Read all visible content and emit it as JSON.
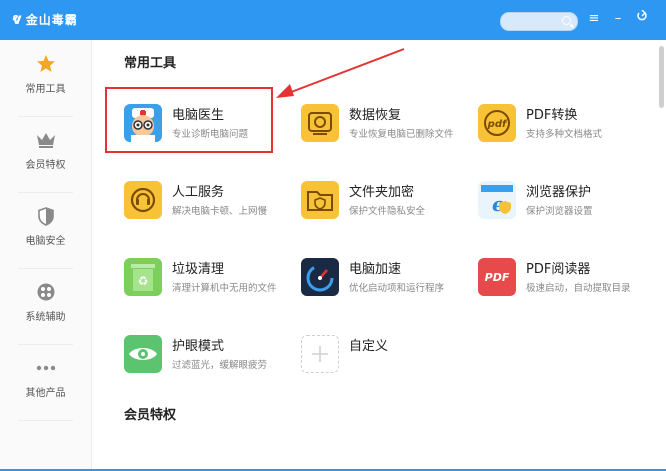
{
  "app": {
    "title": "金山毒霸"
  },
  "window_controls": [
    "menu-icon",
    "minimize-icon",
    "restore-icon"
  ],
  "sidebar": {
    "items": [
      {
        "label": "常用工具",
        "icon": "star-icon",
        "active": true
      },
      {
        "label": "会员特权",
        "icon": "crown-icon"
      },
      {
        "label": "电脑安全",
        "icon": "shield-icon"
      },
      {
        "label": "系统辅助",
        "icon": "settings-circle-icon"
      },
      {
        "label": "其他产品",
        "icon": "more-dots-icon"
      }
    ]
  },
  "main": {
    "section1_title": "常用工具",
    "section2_title": "会员特权",
    "tools": [
      {
        "name": "电脑医生",
        "desc": "专业诊断电脑问题",
        "icon": "doctor-icon"
      },
      {
        "name": "数据恢复",
        "desc": "专业恢复电脑已删除文件",
        "icon": "data-recovery-icon"
      },
      {
        "name": "PDF转换",
        "desc": "支持多种文档格式",
        "icon": "pdf-convert-icon",
        "icon_text": "pdf"
      },
      {
        "name": "人工服务",
        "desc": "解决电脑卡顿、上网慢",
        "icon": "headset-icon"
      },
      {
        "name": "文件夹加密",
        "desc": "保护文件隐私安全",
        "icon": "folder-lock-icon"
      },
      {
        "name": "浏览器保护",
        "desc": "保护浏览器设置",
        "icon": "browser-shield-icon"
      },
      {
        "name": "垃圾清理",
        "desc": "清理计算机中无用的文件",
        "icon": "recycle-bin-icon"
      },
      {
        "name": "电脑加速",
        "desc": "优化启动项和运行程序",
        "icon": "speedometer-icon"
      },
      {
        "name": "PDF阅读器",
        "desc": "极速启动，自动提取目录",
        "icon": "pdf-reader-icon",
        "icon_text": "PDF"
      },
      {
        "name": "护眼模式",
        "desc": "过滤蓝光，缓解眼疲劳",
        "icon": "eye-icon"
      },
      {
        "name": "自定义",
        "desc": "",
        "icon": "add-icon"
      }
    ]
  },
  "colors": {
    "titlebar": "#2e97f2",
    "highlight": "#e53333",
    "accent_star": "#f5a623"
  }
}
